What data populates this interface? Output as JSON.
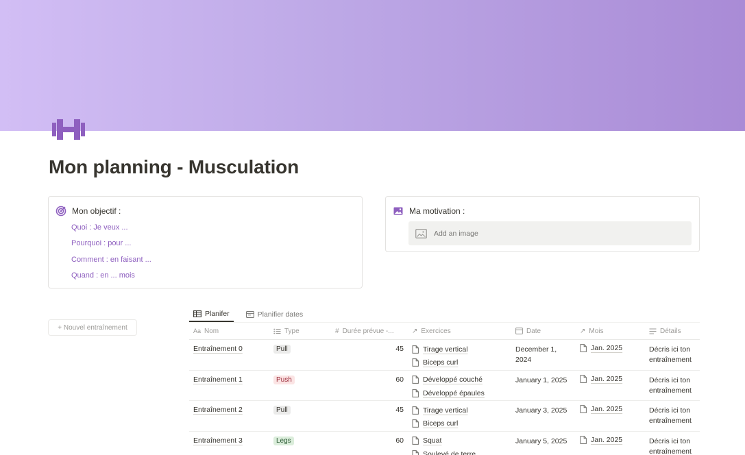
{
  "page": {
    "title": "Mon planning - Musculation",
    "icon": "dumbbell-icon",
    "accent": "#8e5fbf",
    "cover_from": "#d2bef5",
    "cover_to": "#a98bd6"
  },
  "objective": {
    "heading": "Mon objectif :",
    "icon": "target-icon",
    "lines": [
      "Quoi : Je veux ...",
      "Pourquoi : pour ...",
      "Comment : en faisant ...",
      "Quand : en ... mois"
    ]
  },
  "motivation": {
    "heading": "Ma motivation :",
    "icon": "image-icon",
    "placeholder": "Add an image"
  },
  "new_button": "+ Nouvel entraînement",
  "tabs": [
    {
      "label": "Planifer",
      "icon": "table-icon",
      "active": true
    },
    {
      "label": "Planifier dates",
      "icon": "calendar-icon",
      "active": false
    }
  ],
  "table": {
    "columns": [
      {
        "label": "Nom",
        "icon": "Aa"
      },
      {
        "label": "Type",
        "icon": "list-icon"
      },
      {
        "label": "Durée prévue -...",
        "icon": "#"
      },
      {
        "label": "Exercices",
        "icon": "arrow-icon"
      },
      {
        "label": "Date",
        "icon": "calendar-icon"
      },
      {
        "label": "Mois",
        "icon": "arrow-icon"
      },
      {
        "label": "Détails",
        "icon": "text-icon"
      }
    ],
    "rows": [
      {
        "name": "Entraînement 0",
        "type": "Pull",
        "type_bg": "#ebebea",
        "type_fg": "#37352f",
        "duration": "45",
        "exercises": [
          "Tirage vertical",
          "Biceps curl"
        ],
        "date": "December 1, 2024",
        "month": "Jan. 2025",
        "details": [
          "Décris ici ton",
          "entraînement"
        ]
      },
      {
        "name": "Entraînement 1",
        "type": "Push",
        "type_bg": "#fbe4e4",
        "type_fg": "#9b2c3b",
        "duration": "60",
        "exercises": [
          "Développé couché",
          "Développé épaules"
        ],
        "date": "January 1, 2025",
        "month": "Jan. 2025",
        "details": [
          "Décris ici ton",
          "entraînement"
        ]
      },
      {
        "name": "Entraînement 2",
        "type": "Pull",
        "type_bg": "#ebebea",
        "type_fg": "#37352f",
        "duration": "45",
        "exercises": [
          "Tirage vertical",
          "Biceps curl"
        ],
        "date": "January 3, 2025",
        "month": "Jan. 2025",
        "details": [
          "Décris ici ton",
          "entraînement"
        ]
      },
      {
        "name": "Entraînement 3",
        "type": "Legs",
        "type_bg": "#dbeddb",
        "type_fg": "#2b5a34",
        "duration": "60",
        "exercises": [
          "Squat",
          "Soulevé de terre"
        ],
        "date": "January 5, 2025",
        "month": "Jan. 2025",
        "details": [
          "Décris ici ton",
          "entraînement"
        ]
      }
    ]
  }
}
